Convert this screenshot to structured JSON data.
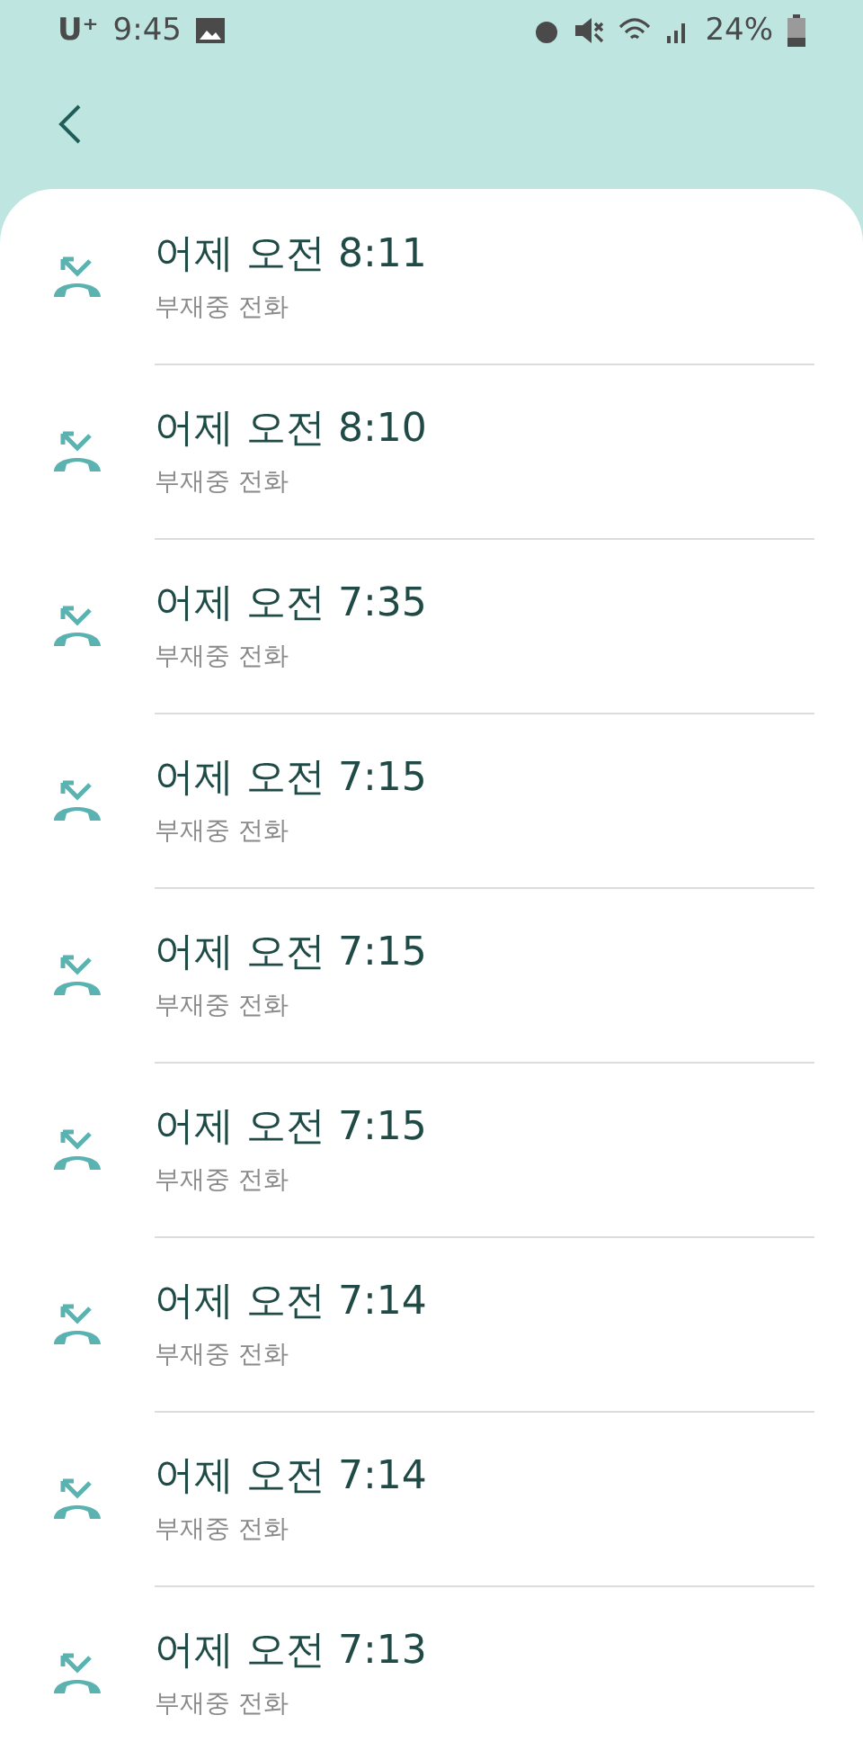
{
  "status_bar": {
    "carrier": "U⁺",
    "time": "9:45",
    "battery": "24%"
  },
  "calls": [
    {
      "time": "어제 오전 8:11",
      "type": "부재중 전화"
    },
    {
      "time": "어제 오전 8:10",
      "type": "부재중 전화"
    },
    {
      "time": "어제 오전 7:35",
      "type": "부재중 전화"
    },
    {
      "time": "어제 오전 7:15",
      "type": "부재중 전화"
    },
    {
      "time": "어제 오전 7:15",
      "type": "부재중 전화"
    },
    {
      "time": "어제 오전 7:15",
      "type": "부재중 전화"
    },
    {
      "time": "어제 오전 7:14",
      "type": "부재중 전화"
    },
    {
      "time": "어제 오전 7:14",
      "type": "부재중 전화"
    },
    {
      "time": "어제 오전 7:13",
      "type": "부재중 전화"
    }
  ]
}
